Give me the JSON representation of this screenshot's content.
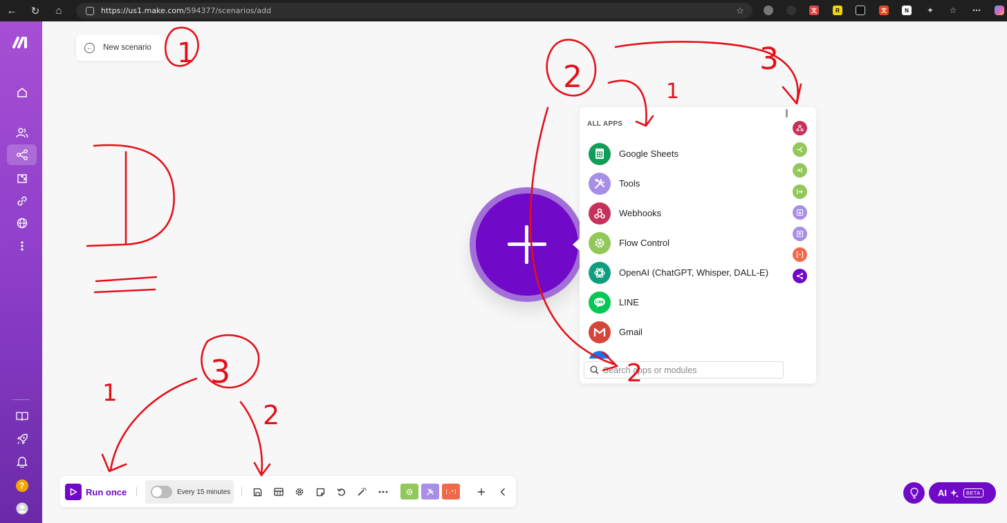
{
  "browser": {
    "url_host": "https://us1.make.com",
    "url_path": "/594377/scenarios/add",
    "ext_badges": [
      "R",
      "N",
      "A"
    ]
  },
  "sidebar": {
    "items": [
      "home-icon",
      "team-icon",
      "scenarios-icon",
      "templates-icon",
      "connections-icon",
      "webhooks-icon",
      "more-icon"
    ],
    "bottom": [
      "help-book-icon",
      "rocket-icon",
      "bell-icon",
      "help-icon",
      "avatar-icon"
    ],
    "help_label": "?"
  },
  "header": {
    "back_label": "New scenario"
  },
  "picker": {
    "heading": "ALL APPS",
    "apps": [
      {
        "name": "Google Sheets",
        "color": "#0f9d58",
        "icon": "sheets-icon"
      },
      {
        "name": "Tools",
        "color": "#a88ee6",
        "icon": "tools-icon"
      },
      {
        "name": "Webhooks",
        "color": "#c6305a",
        "icon": "webhooks-icon"
      },
      {
        "name": "Flow Control",
        "color": "#92c85a",
        "icon": "gear-icon"
      },
      {
        "name": "OpenAI (ChatGPT, Whisper, DALL-E)",
        "color": "#119e7f",
        "icon": "openai-icon"
      },
      {
        "name": "LINE",
        "color": "#06c755",
        "icon": "line-icon"
      },
      {
        "name": "Gmail",
        "color": "#d5463a",
        "icon": "gmail-icon"
      }
    ],
    "filters": [
      "#c6305a",
      "#92c85a",
      "#92c85a",
      "#92c85a",
      "#a88ee6",
      "#a88ee6",
      "#f06a4a",
      "#7009c8"
    ],
    "search_placeholder": "Search apps or modules"
  },
  "toolbar": {
    "run_label": "Run once",
    "schedule_label": "Every 15 minutes",
    "app_colors": [
      "#92c85a",
      "#a88ee6",
      "#f06a4a"
    ],
    "text_parser_label": "[.*]"
  },
  "assistant": {
    "ai_label": "AI",
    "beta_label": "BETA"
  },
  "annotations": {
    "color": "#e3101a",
    "numbers": [
      "1",
      "2",
      "3",
      "1",
      "2",
      "3",
      "1",
      "2"
    ]
  }
}
